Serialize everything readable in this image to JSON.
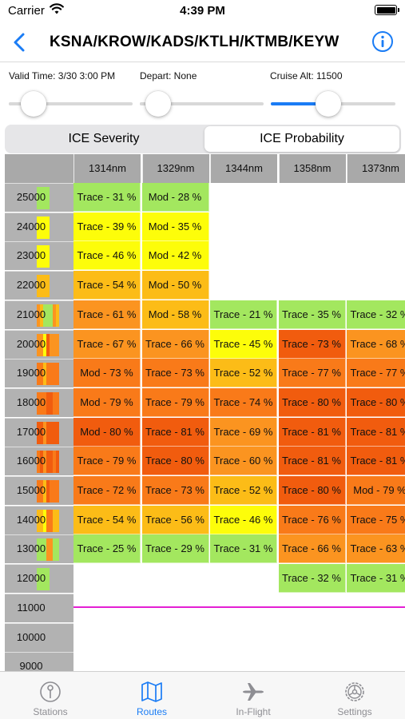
{
  "status_bar": {
    "carrier": "Carrier",
    "time": "4:39 PM"
  },
  "nav": {
    "title": "KSNA/KROW/KADS/KTLH/KTMB/KEYW",
    "back_icon": "chevron-left-icon",
    "info_icon": "info-circle-icon"
  },
  "params": {
    "valid_time": "Valid Time: 3/30 3:00 PM",
    "depart": "Depart: None",
    "cruise_alt": "Cruise Alt: 11500"
  },
  "sliders": [
    {
      "name": "valid-time",
      "value": 0.12
    },
    {
      "name": "depart",
      "value": 0.06
    },
    {
      "name": "cruise-alt",
      "value": 0.45
    }
  ],
  "segments": {
    "items": [
      "ICE Severity",
      "ICE Probability"
    ],
    "selected_index": 1
  },
  "colors": {
    "accent": "#1a7cf5",
    "cruise_line": "#e41fd3",
    "header_gray": "#a9a9a9",
    "level_green": "#a3e75f",
    "level_yellow": "#fdfd0a",
    "level_amber": "#fcbc17",
    "level_orange": "#fb9420",
    "level_deep_orange": "#f97a19",
    "level_red": "#f15c0e"
  },
  "grid": {
    "columns": [
      "1314nm",
      "1329nm",
      "1344nm",
      "1358nm",
      "1373nm"
    ],
    "cruise_altitude_row": "11000",
    "rows": [
      {
        "altitude": "25000",
        "cells": [
          {
            "text": "Trace - 31 %",
            "level": "green"
          },
          {
            "text": "Mod - 28 %",
            "level": "green"
          },
          null,
          null,
          null
        ]
      },
      {
        "altitude": "24000",
        "cells": [
          {
            "text": "Trace - 39 %",
            "level": "yellow"
          },
          {
            "text": "Mod - 35 %",
            "level": "yellow"
          },
          null,
          null,
          null
        ]
      },
      {
        "altitude": "23000",
        "cells": [
          {
            "text": "Trace - 46 %",
            "level": "yellow"
          },
          {
            "text": "Mod - 42 %",
            "level": "yellow"
          },
          null,
          null,
          null
        ]
      },
      {
        "altitude": "22000",
        "cells": [
          {
            "text": "Trace - 54 %",
            "level": "amber"
          },
          {
            "text": "Mod - 50 %",
            "level": "amber"
          },
          null,
          null,
          null
        ]
      },
      {
        "altitude": "21000",
        "cells": [
          {
            "text": "Trace - 61 %",
            "level": "orange"
          },
          {
            "text": "Mod - 58 %",
            "level": "amber"
          },
          {
            "text": "Trace - 21 %",
            "level": "green"
          },
          {
            "text": "Trace - 35 %",
            "level": "green"
          },
          {
            "text": "Trace - 32 %",
            "level": "green"
          }
        ]
      },
      {
        "altitude": "20000",
        "cells": [
          {
            "text": "Trace - 67 %",
            "level": "orange"
          },
          {
            "text": "Trace - 66 %",
            "level": "orange"
          },
          {
            "text": "Trace - 45 %",
            "level": "yellow"
          },
          {
            "text": "Trace - 73 %",
            "level": "red"
          },
          {
            "text": "Trace - 68 %",
            "level": "orange"
          }
        ]
      },
      {
        "altitude": "19000",
        "cells": [
          {
            "text": "Mod - 73 %",
            "level": "deep_orange"
          },
          {
            "text": "Trace - 73 %",
            "level": "deep_orange"
          },
          {
            "text": "Trace - 52 %",
            "level": "amber"
          },
          {
            "text": "Trace - 77 %",
            "level": "deep_orange"
          },
          {
            "text": "Trace - 77 %",
            "level": "deep_orange"
          }
        ]
      },
      {
        "altitude": "18000",
        "cells": [
          {
            "text": "Mod - 79 %",
            "level": "deep_orange"
          },
          {
            "text": "Trace - 79 %",
            "level": "deep_orange"
          },
          {
            "text": "Trace - 74 %",
            "level": "deep_orange"
          },
          {
            "text": "Trace - 80 %",
            "level": "red"
          },
          {
            "text": "Trace - 80 %",
            "level": "red"
          }
        ]
      },
      {
        "altitude": "17000",
        "cells": [
          {
            "text": "Mod - 80 %",
            "level": "red"
          },
          {
            "text": "Trace - 81 %",
            "level": "red"
          },
          {
            "text": "Trace - 69 %",
            "level": "orange"
          },
          {
            "text": "Trace - 81 %",
            "level": "red"
          },
          {
            "text": "Trace - 81 %",
            "level": "red"
          }
        ]
      },
      {
        "altitude": "16000",
        "cells": [
          {
            "text": "Trace - 79 %",
            "level": "deep_orange"
          },
          {
            "text": "Trace - 80 %",
            "level": "red"
          },
          {
            "text": "Trace - 60 %",
            "level": "orange"
          },
          {
            "text": "Trace - 81 %",
            "level": "red"
          },
          {
            "text": "Trace - 81 %",
            "level": "red"
          }
        ]
      },
      {
        "altitude": "15000",
        "cells": [
          {
            "text": "Trace - 72 %",
            "level": "deep_orange"
          },
          {
            "text": "Trace - 73 %",
            "level": "deep_orange"
          },
          {
            "text": "Trace - 52 %",
            "level": "amber"
          },
          {
            "text": "Trace - 80 %",
            "level": "red"
          },
          {
            "text": "Mod - 79 %",
            "level": "deep_orange"
          }
        ]
      },
      {
        "altitude": "14000",
        "cells": [
          {
            "text": "Trace - 54 %",
            "level": "amber"
          },
          {
            "text": "Trace - 56 %",
            "level": "amber"
          },
          {
            "text": "Trace - 46 %",
            "level": "yellow"
          },
          {
            "text": "Trace - 76 %",
            "level": "deep_orange"
          },
          {
            "text": "Trace - 75 %",
            "level": "deep_orange"
          }
        ]
      },
      {
        "altitude": "13000",
        "cells": [
          {
            "text": "Trace - 25 %",
            "level": "green"
          },
          {
            "text": "Trace - 29 %",
            "level": "green"
          },
          {
            "text": "Trace - 31 %",
            "level": "green"
          },
          {
            "text": "Trace - 66 %",
            "level": "orange"
          },
          {
            "text": "Trace - 63 %",
            "level": "orange"
          }
        ]
      },
      {
        "altitude": "12000",
        "cells": [
          null,
          null,
          null,
          {
            "text": "Trace - 32 %",
            "level": "green"
          },
          {
            "text": "Trace - 31 %",
            "level": "green"
          }
        ]
      },
      {
        "altitude": "11000",
        "cells": [
          null,
          null,
          null,
          null,
          null
        ]
      },
      {
        "altitude": "10000",
        "cells": [
          null,
          null,
          null,
          null,
          null
        ]
      },
      {
        "altitude": "9000",
        "cells": [
          null,
          null,
          null,
          null,
          null
        ]
      }
    ]
  },
  "tabs": [
    {
      "label": "Stations",
      "icon": "pin-icon",
      "active": false
    },
    {
      "label": "Routes",
      "icon": "map-icon",
      "active": true
    },
    {
      "label": "In-Flight",
      "icon": "airplane-icon",
      "active": false
    },
    {
      "label": "Settings",
      "icon": "gear-icon",
      "active": false
    }
  ]
}
